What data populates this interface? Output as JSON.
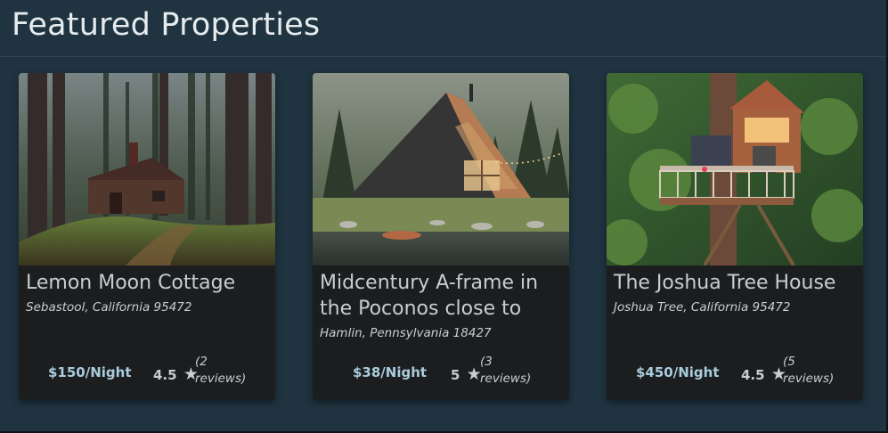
{
  "header": {
    "title": "Featured Properties"
  },
  "properties": [
    {
      "title": "Lemon Moon Cottage",
      "location": "Sebastool, California 95472",
      "price": "$150/Night",
      "rating": "4.5",
      "reviews_open": "(2",
      "reviews_close": "reviews)",
      "image": "forest-cabin-photo"
    },
    {
      "title": "Midcentury A-frame in the Poconos close to",
      "location": "Hamlin, Pennsylvania 18427",
      "price": "$38/Night",
      "rating": "5",
      "reviews_open": "(3",
      "reviews_close": "reviews)",
      "image": "a-frame-lake-photo"
    },
    {
      "title": "The Joshua Tree House",
      "location": "Joshua Tree, California 95472",
      "price": "$450/Night",
      "rating": "4.5",
      "reviews_open": "(5",
      "reviews_close": "reviews)",
      "image": "treehouse-photo"
    }
  ],
  "star_glyph": "★",
  "colors": {
    "background": "#1f3440",
    "card": "#1c1d1f",
    "price": "#a9ccdc",
    "text": "#c9cdd0"
  }
}
